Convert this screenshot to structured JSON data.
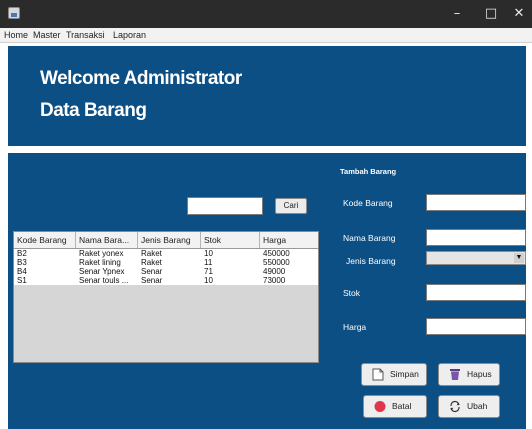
{
  "menu": {
    "items": [
      "Home",
      "Master",
      "Transaksi",
      "Laporan"
    ]
  },
  "header": {
    "line1": "Welcome Administrator",
    "line2": "Data Barang"
  },
  "search": {
    "button_label": "Cari"
  },
  "table": {
    "columns": [
      "Kode Barang",
      "Nama Bara...",
      "Jenis Barang",
      "Stok",
      "Harga"
    ],
    "rows": [
      [
        "B2",
        "Raket yonex",
        "Raket",
        "10",
        "450000"
      ],
      [
        "B3",
        "Raket lining",
        "Raket",
        "11",
        "550000"
      ],
      [
        "B4",
        "Senar Ypnex",
        "Senar",
        "71",
        "49000"
      ],
      [
        "S1",
        "Senar touls ...",
        "Senar",
        "10",
        "73000"
      ]
    ]
  },
  "form": {
    "title": "Tambah Barang",
    "labels": {
      "kode": "Kode Barang",
      "nama": "Nama Barang",
      "jenis": "Jenis Barang",
      "stok": "Stok",
      "harga": "Harga"
    }
  },
  "buttons": {
    "simpan": "Simpan",
    "hapus": "Hapus",
    "batal": "Batal",
    "ubah": "Ubah"
  },
  "colors": {
    "panel": "#0c4f84",
    "titlebar": "#2b2b2b",
    "batal_icon": "#e0364b",
    "hapus_icon": "#7a56a8"
  },
  "icons": {
    "app": "java-app-icon",
    "minimize": "minimize-icon",
    "maximize": "maximize-icon",
    "close": "close-icon",
    "simpan": "save-icon",
    "hapus": "trash-icon",
    "batal": "cancel-icon",
    "ubah": "refresh-icon"
  }
}
